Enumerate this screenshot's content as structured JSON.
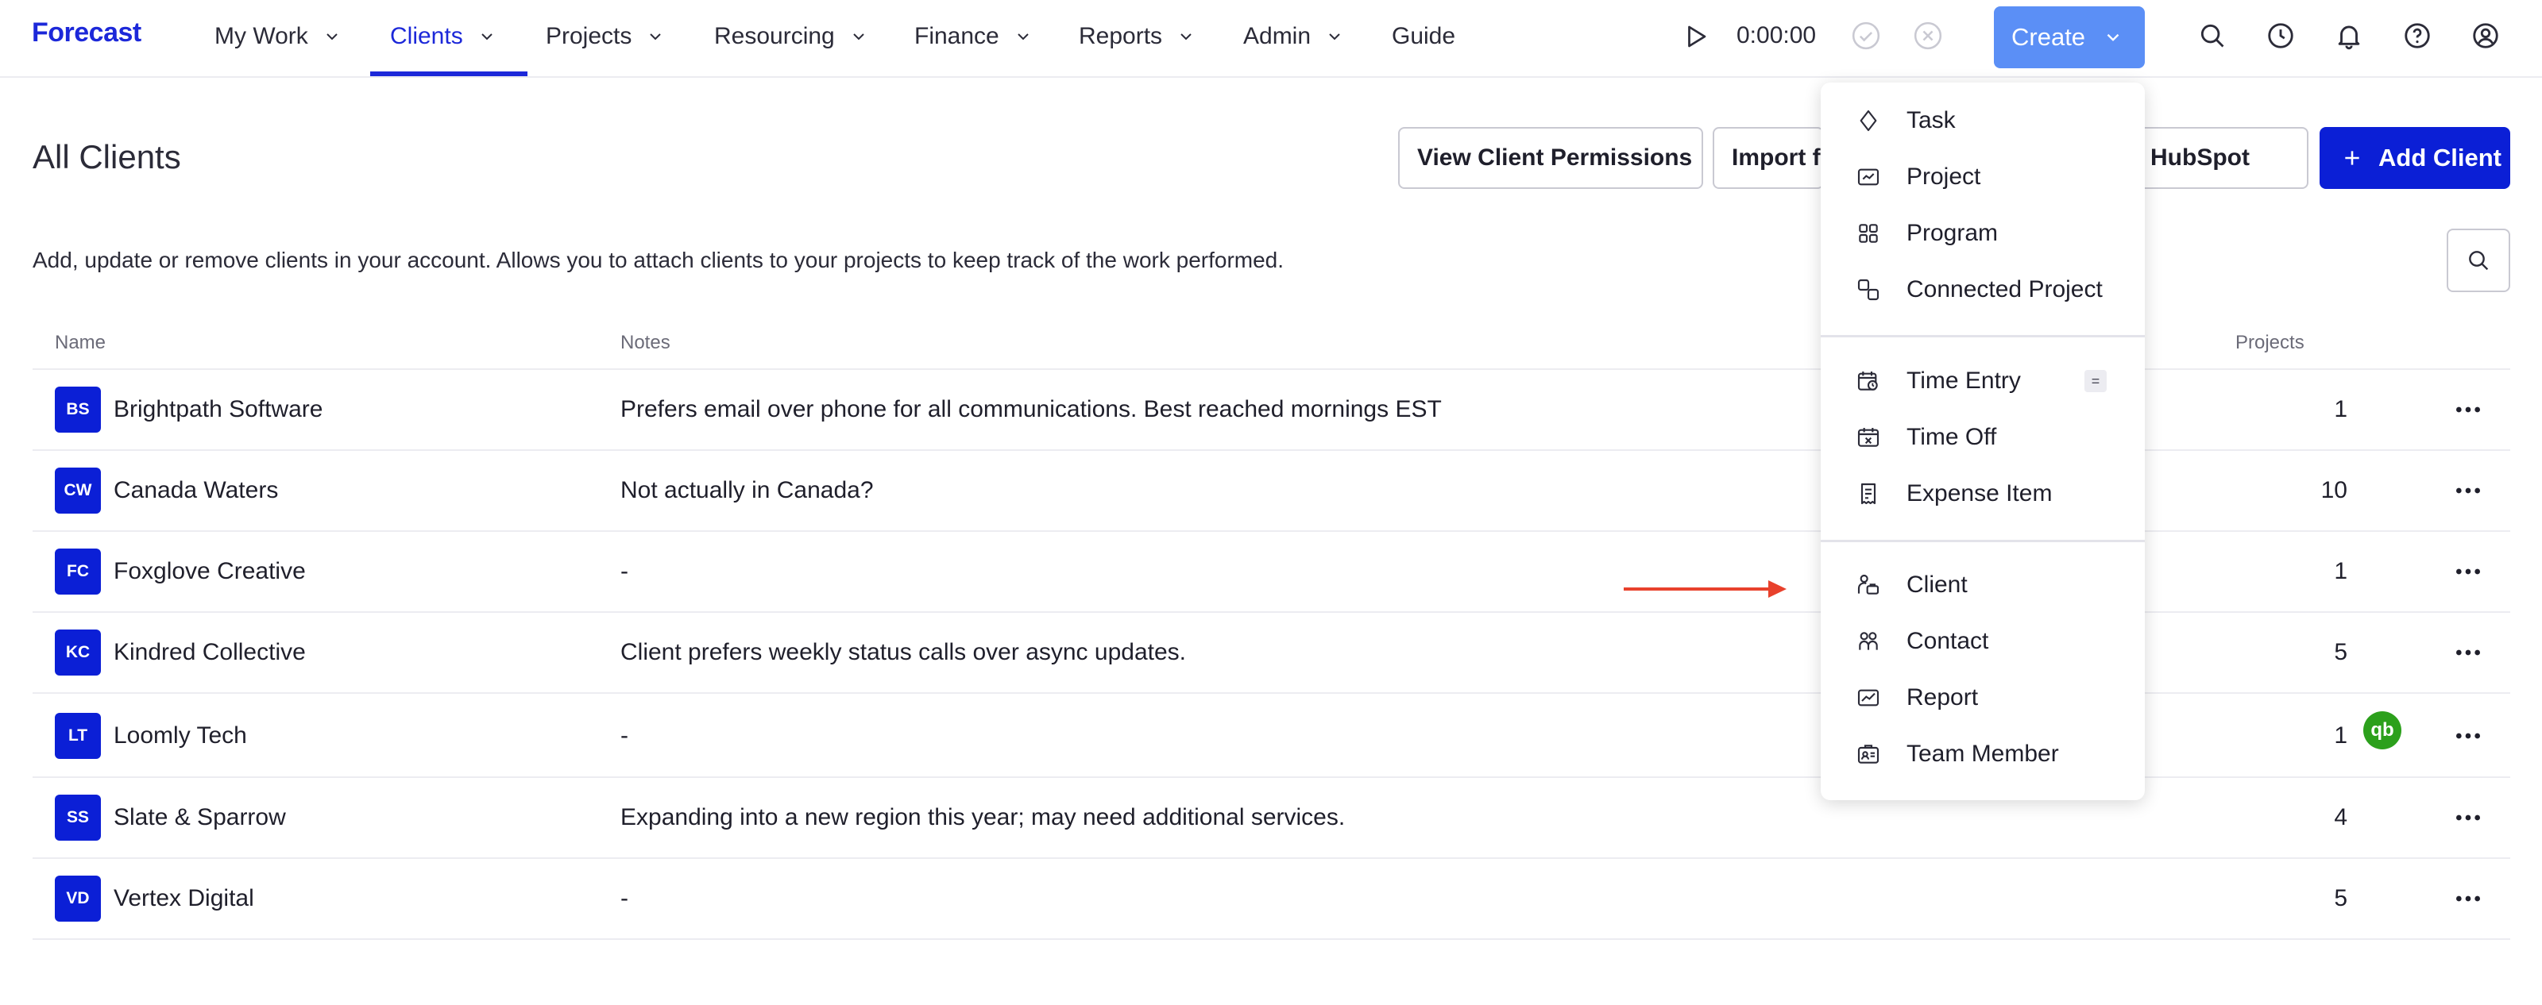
{
  "nav": {
    "logo": "Forecast",
    "items": [
      {
        "label": "My Work"
      },
      {
        "label": "Clients"
      },
      {
        "label": "Projects"
      },
      {
        "label": "Resourcing"
      },
      {
        "label": "Finance"
      },
      {
        "label": "Reports"
      },
      {
        "label": "Admin"
      },
      {
        "label": "Guide"
      }
    ],
    "active_item": "Clients",
    "timer": "0:00:00",
    "create_label": "Create"
  },
  "page": {
    "title": "All Clients",
    "description": "Add, update or remove clients in your account. Allows you to attach clients to your projects to keep track of the work performed.",
    "buttons": {
      "view_permissions": "View Client Permissions",
      "import_from": "Import f",
      "hubspot": "rom HubSpot",
      "add_client": "Add Client"
    }
  },
  "table": {
    "columns": {
      "name": "Name",
      "notes": "Notes",
      "projects": "Projects"
    },
    "rows": [
      {
        "initials": "BS",
        "name": "Brightpath Software",
        "notes": "Prefers email over phone for all communications. Best reached mornings EST",
        "projects": "1"
      },
      {
        "initials": "CW",
        "name": "Canada Waters",
        "notes": "Not actually in Canada?",
        "projects": "10"
      },
      {
        "initials": "FC",
        "name": "Foxglove Creative",
        "notes": "-",
        "projects": "1"
      },
      {
        "initials": "KC",
        "name": "Kindred Collective",
        "notes": "Client prefers weekly status calls over async updates.",
        "projects": "5"
      },
      {
        "initials": "LT",
        "name": "Loomly Tech",
        "notes": "-",
        "projects": "1",
        "integration_badge": "qb"
      },
      {
        "initials": "SS",
        "name": "Slate & Sparrow",
        "notes": "Expanding into a new region this year; may need additional services.",
        "projects": "4"
      },
      {
        "initials": "VD",
        "name": "Vertex Digital",
        "notes": "-",
        "projects": "5"
      }
    ]
  },
  "create_menu": {
    "items": [
      {
        "label": "Task",
        "icon": "diamond-icon"
      },
      {
        "label": "Project",
        "icon": "project-icon"
      },
      {
        "label": "Program",
        "icon": "grid-icon"
      },
      {
        "label": "Connected Project",
        "icon": "connected-icon"
      },
      {
        "label": "Time Entry",
        "icon": "calendar-clock-icon",
        "shortcut": "="
      },
      {
        "label": "Time Off",
        "icon": "calendar-x-icon"
      },
      {
        "label": "Expense Item",
        "icon": "receipt-icon"
      },
      {
        "label": "Client",
        "icon": "client-icon"
      },
      {
        "label": "Contact",
        "icon": "contact-icon"
      },
      {
        "label": "Report",
        "icon": "report-icon"
      },
      {
        "label": "Team Member",
        "icon": "id-card-icon"
      }
    ]
  },
  "colors": {
    "brand": "#1c28d9",
    "create_button": "#5b8ff6",
    "add_client": "#0b1fd6",
    "avatar": "#0b1fd6",
    "quickbooks": "#2ca01c",
    "annotation_arrow": "#e8412c"
  }
}
